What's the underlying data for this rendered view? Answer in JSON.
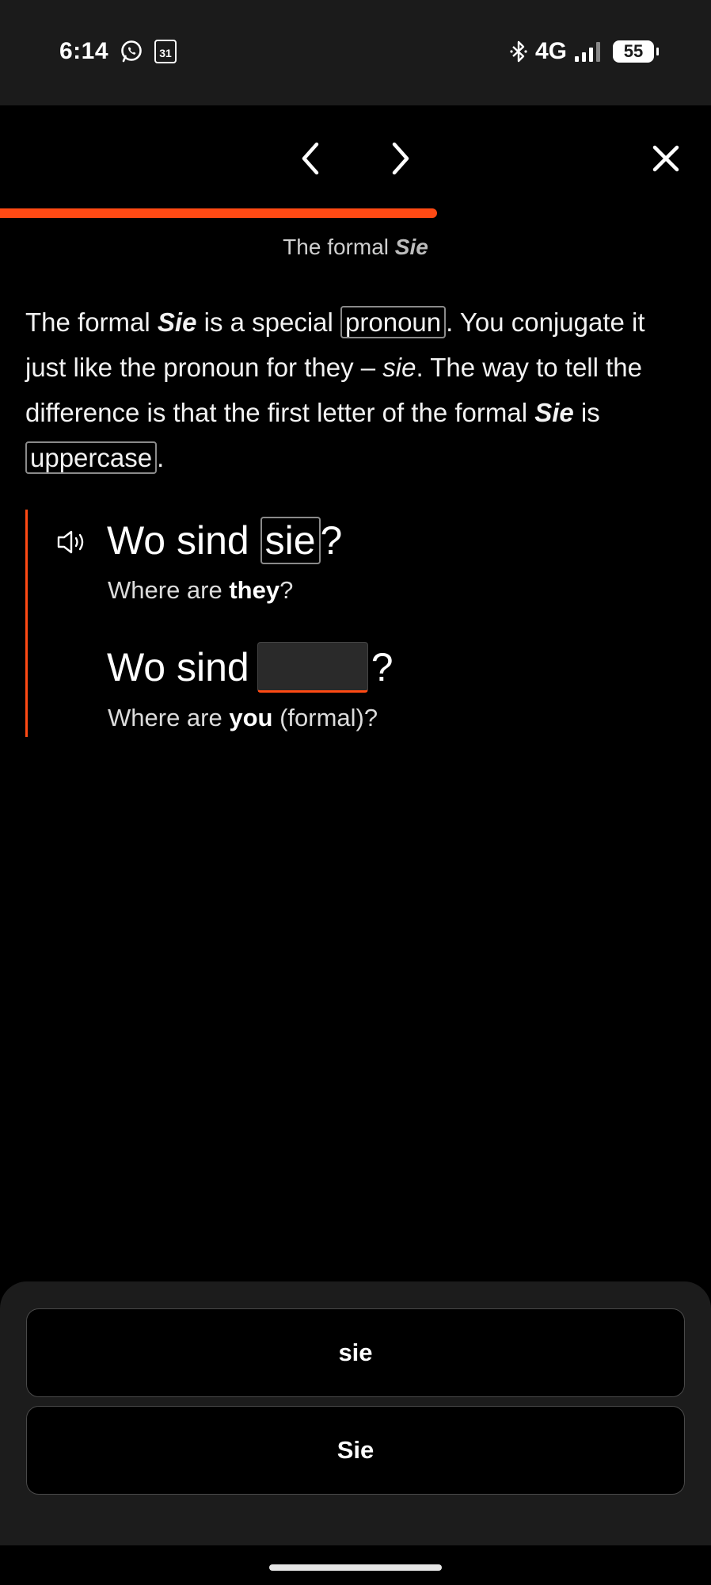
{
  "status_bar": {
    "time": "6:14",
    "calendar_day": "31",
    "network": "4G",
    "battery": "55"
  },
  "nav": {
    "progress_percent": 61.5
  },
  "lesson": {
    "title_prefix": "The formal ",
    "title_emphasis": "Sie"
  },
  "explanation": {
    "p1": "The formal ",
    "p2": "Sie",
    "p3": " is a special ",
    "term1": "pronoun",
    "p4": ". You conjugate it just like the pronoun for they – ",
    "p5": "sie",
    "p6": ". The way to tell the difference is that the first letter of the formal ",
    "p7": "Sie",
    "p8": " is ",
    "term2": "uppercase",
    "p9": "."
  },
  "examples": {
    "ex1": {
      "prefix": "Wo sind ",
      "word": "sie",
      "suffix": "?",
      "tr_prefix": "Where are ",
      "tr_bold": "they",
      "tr_suffix": "?"
    },
    "ex2": {
      "prefix": "Wo sind",
      "suffix": "?",
      "tr_prefix": "Where are ",
      "tr_bold": "you",
      "tr_suffix": " (formal)?"
    }
  },
  "answers": {
    "option1": "sie",
    "option2": "Sie"
  },
  "colors": {
    "accent": "#ff4a14",
    "status_bar_bg": "#1b1b1b",
    "panel_bg": "#1c1c1c"
  },
  "icons": {
    "whatsapp": "whatsapp-icon",
    "calendar": "calendar-icon",
    "bluetooth": "bluetooth-icon",
    "signal": "signal-icon",
    "battery": "battery-icon",
    "back": "chevron-left-icon",
    "forward": "chevron-right-icon",
    "close": "close-icon",
    "speaker": "speaker-icon"
  }
}
